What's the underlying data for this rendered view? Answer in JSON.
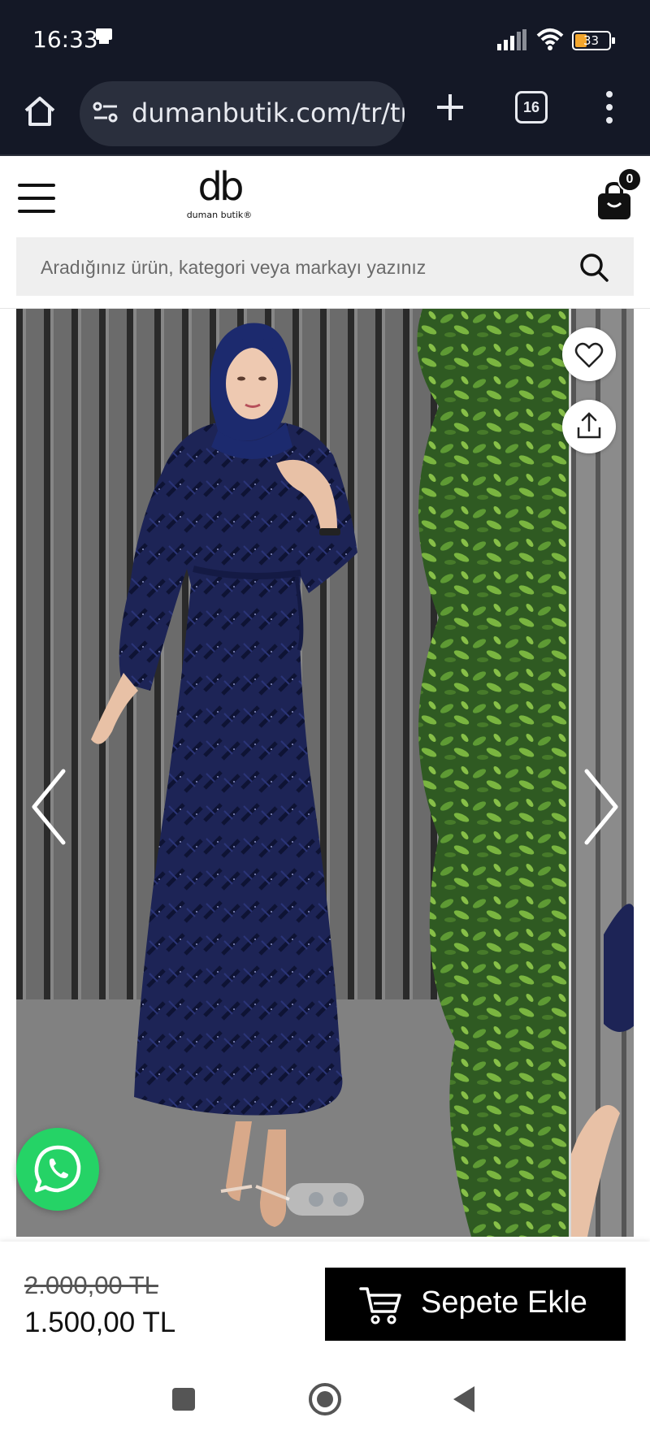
{
  "status_bar": {
    "time": "16:33",
    "battery": "33"
  },
  "browser": {
    "url": "dumanbutik.com/tr/tr/",
    "tab_count": "16"
  },
  "site": {
    "logo_mark": "db",
    "logo_name": "duman butik®",
    "cart_count": "0",
    "search_placeholder": "Aradığınız ürün, kategori veya markayı yazınız"
  },
  "product": {
    "old_price": "2.000,00 TL",
    "price": "1.500,00 TL",
    "add_to_cart": "Sepete Ekle",
    "gallery_slides": 2,
    "active_slide": 1
  },
  "colors": {
    "dress": "#1c2455",
    "brand_black": "#000000",
    "whatsapp": "#25d366"
  }
}
